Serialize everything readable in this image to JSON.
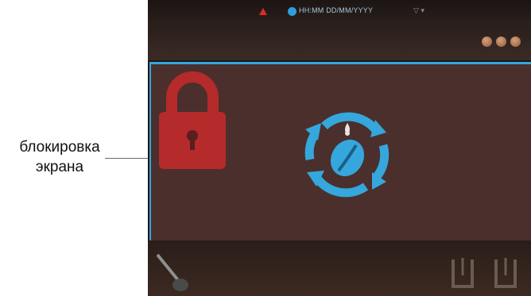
{
  "annotation": {
    "line1": "блокировка",
    "line2": "экрана"
  },
  "status_bar": {
    "datetime": "HH:MM DD/MM/YYYY",
    "dropdown": "▽ ▾"
  },
  "icons": {
    "warning": "warning-icon",
    "clock": "clock-icon",
    "lock": "padlock-icon",
    "sync": "rinse-cycle-icon",
    "steam": "steam-wand-icon",
    "cup": "cup-icon"
  },
  "colors": {
    "accent": "#35a7dc",
    "lock": "#b52a2a",
    "panel": "#4a2f2d",
    "warning": "#e02828"
  }
}
